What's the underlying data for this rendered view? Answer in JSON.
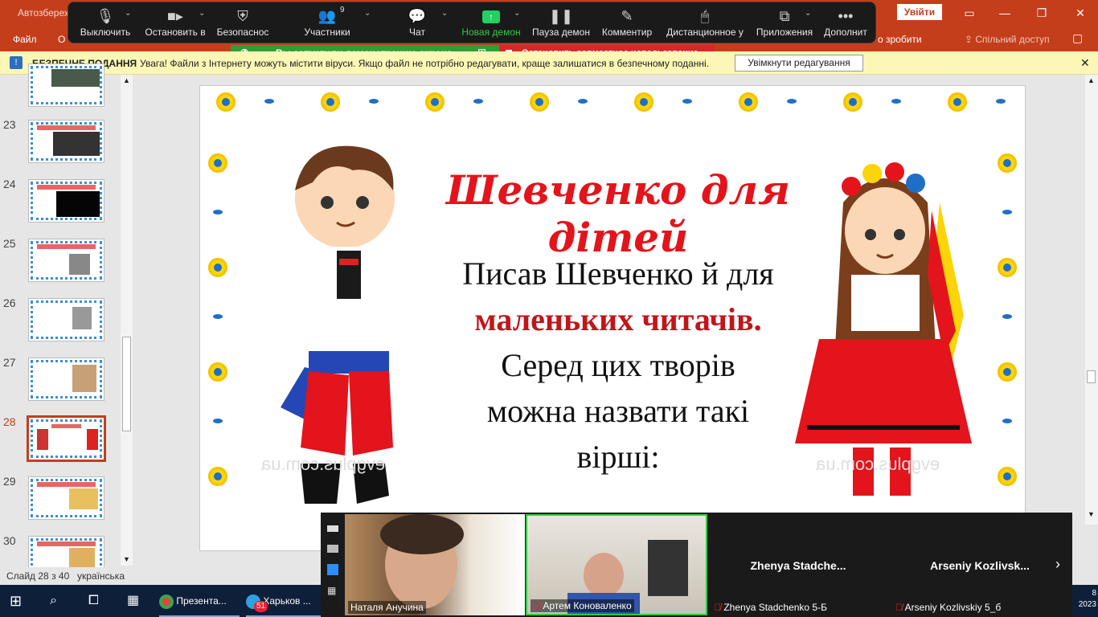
{
  "titlebar": {
    "autosave": "Автозбереж",
    "login": "Увійти",
    "ribbon_file": "Файл",
    "ribbon_partial": "О",
    "ribbon_right": "о зробити",
    "share": "Спільний доступ"
  },
  "zoom": {
    "items": [
      {
        "label": "Выключить",
        "icon": "microphone-icon"
      },
      {
        "label": "Остановить в",
        "icon": "video-camera-icon"
      },
      {
        "label": "Безопаснос",
        "icon": "shield-icon"
      },
      {
        "label": "Участники",
        "icon": "participants-icon",
        "count": "9"
      },
      {
        "label": "Чат",
        "icon": "chat-icon"
      },
      {
        "label": "Новая демон",
        "icon": "share-screen-icon"
      },
      {
        "label": "Пауза демон",
        "icon": "pause-icon"
      },
      {
        "label": "Комментир",
        "icon": "annotate-icon"
      },
      {
        "label": "Дистанционное у",
        "icon": "remote-control-icon"
      },
      {
        "label": "Приложения",
        "icon": "apps-icon"
      },
      {
        "label": "Дополнит",
        "icon": "more-icon"
      }
    ],
    "share_notice": "Вы запустили демонстрацию экрана",
    "stop_share": "Остановить совместное использование"
  },
  "protected_view": {
    "title": "БЕЗПЕЧНЕ ПОДАННЯ",
    "message": "Увага! Файли з Інтернету можуть містити віруси. Якщо файл не потрібно редагувати, краще залишатися в безпечному поданні.",
    "button": "Увімкнути редагування"
  },
  "thumbnails": {
    "numbers": [
      "23",
      "24",
      "25",
      "26",
      "27",
      "28",
      "29",
      "30"
    ],
    "selected": "28"
  },
  "slide": {
    "title": "Шевченко для дітей",
    "line1": "Писав Шевченко й для",
    "line2": "маленьких читачів.",
    "line3": "Серед цих творів",
    "line4": "можна назвати такі",
    "line5": "вірші:",
    "watermark": "evgplus.com.ua"
  },
  "status": {
    "slide_counter": "Слайд 28 з 40",
    "language": "українська"
  },
  "taskbar": {
    "chrome_title": "Презента...",
    "telegram_title": "Харьков ...",
    "telegram_badge": "51",
    "clock_partial": "8",
    "year_partial": "2023"
  },
  "video": {
    "participants": [
      {
        "name": "Наталя Анучина",
        "muted": false
      },
      {
        "name": "Артем Коноваленко",
        "muted": true
      },
      {
        "name": "Zhenya Stadchenko 5-Б",
        "big": "Zhenya  Stadche...",
        "muted": true
      },
      {
        "name": "Arseniy Kozlivskiy 5_б",
        "big": "Arseniy  Kozlivsk...",
        "muted": true
      }
    ]
  }
}
